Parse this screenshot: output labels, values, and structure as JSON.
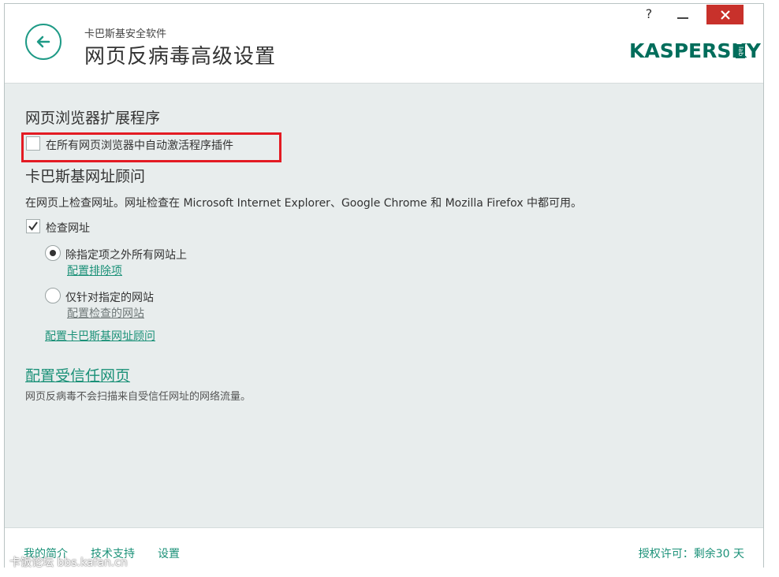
{
  "header": {
    "app_name": "卡巴斯基安全软件",
    "page_title": "网页反病毒高级设置",
    "help_label": "?",
    "logo_text": "KASPERSKY",
    "logo_lab": "lab"
  },
  "browser_ext": {
    "heading": "网页浏览器扩展程序",
    "checkbox_label": "在所有网页浏览器中自动激活程序插件",
    "checked": false
  },
  "url_advisor": {
    "heading": "卡巴斯基网址顾问",
    "description": "在网页上检查网址。网址检查在 Microsoft Internet Explorer、Google Chrome 和 Mozilla Firefox 中都可用。",
    "check_label": "检查网址",
    "checked": true,
    "radio_all": "除指定项之外所有网站上",
    "radio_all_link": "配置排除项",
    "radio_specific": "仅针对指定的网站",
    "radio_specific_link": "配置检查的网站",
    "configure_link": "配置卡巴斯基网址顾问"
  },
  "trusted": {
    "link": "配置受信任网页",
    "description": "网页反病毒不会扫描来自受信任网址的网络流量。"
  },
  "footer": {
    "profile": "我的简介",
    "support": "技术支持",
    "settings": "设置",
    "license": "授权许可：剩余30 天"
  },
  "watermark": "卡饭论坛 bbs.kafan.cn",
  "colors": {
    "accent": "#1b9178",
    "close": "#c8312b",
    "highlight": "#e31b23"
  },
  "icons": [
    "back-arrow-icon",
    "minimize-icon",
    "close-icon",
    "checkmark-icon"
  ]
}
